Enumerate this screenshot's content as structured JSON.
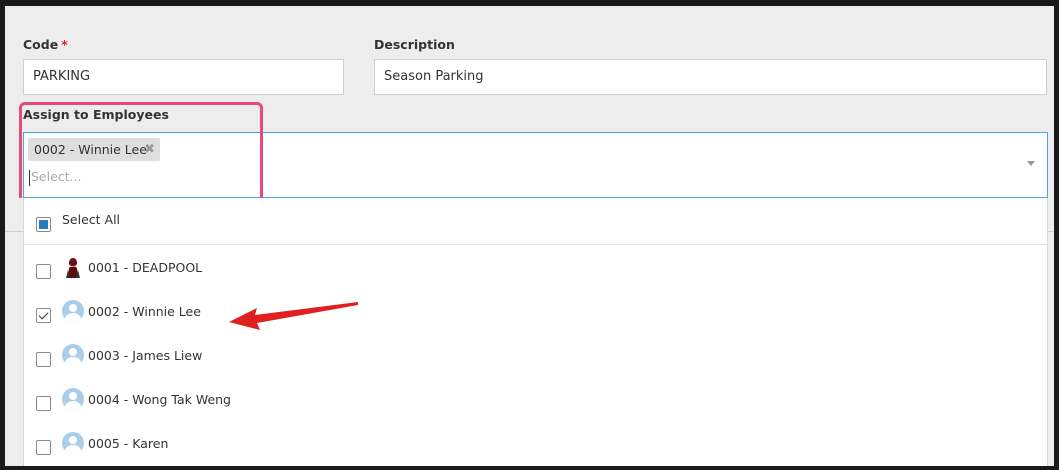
{
  "form": {
    "code": {
      "label": "Code",
      "required_mark": "*",
      "value": "PARKING"
    },
    "description": {
      "label": "Description",
      "value": "Season Parking"
    },
    "assign": {
      "label": "Assign to Employees",
      "selected_tags": [
        "0002 - Winnie Lee"
      ],
      "tag_remove_glyph": "✖",
      "placeholder": "Select..."
    }
  },
  "dropdown": {
    "select_all_label": "Select All",
    "select_all_state": "partial",
    "options": [
      {
        "label": "0001 - DEADPOOL",
        "checked": false,
        "avatar": "deadpool-photo"
      },
      {
        "label": "0002 - Winnie Lee",
        "checked": true,
        "avatar": "default-user-icon"
      },
      {
        "label": "0003 - James Liew",
        "checked": false,
        "avatar": "default-user-icon"
      },
      {
        "label": "0004 - Wong Tak Weng",
        "checked": false,
        "avatar": "default-user-icon"
      },
      {
        "label": "0005 - Karen",
        "checked": false,
        "avatar": "default-user-icon"
      }
    ]
  },
  "colors": {
    "highlight_border": "#e8497b",
    "annotation_arrow": "#e02020",
    "focus_border": "#4aa8d8",
    "checkbox_fill": "#2a78c2"
  }
}
